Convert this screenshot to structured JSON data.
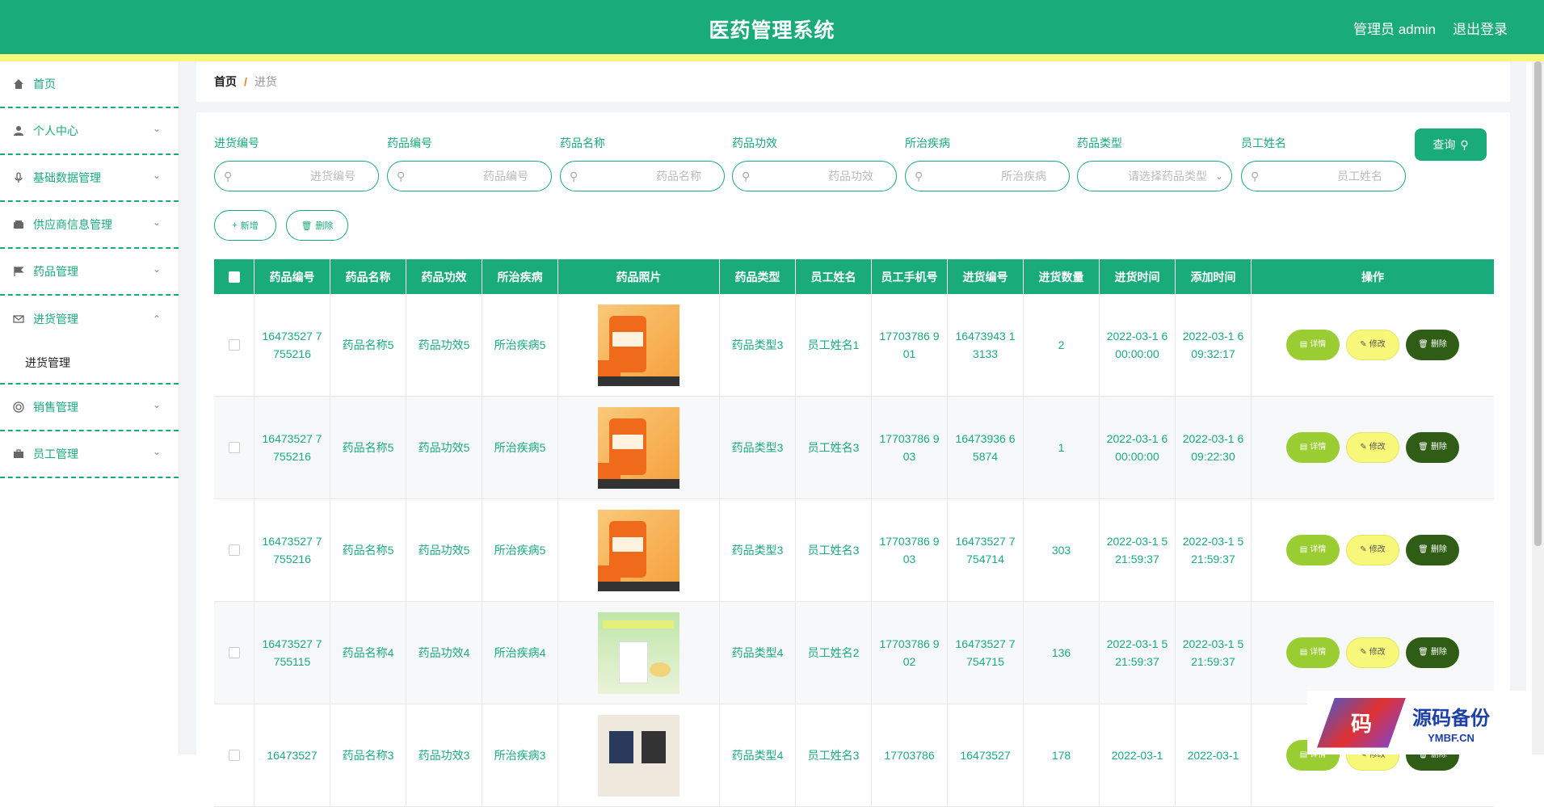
{
  "header": {
    "title": "医药管理系统",
    "user": "管理员 admin",
    "logout": "退出登录"
  },
  "sidebar": {
    "items": [
      {
        "label": "首页",
        "icon": "home-icon"
      },
      {
        "label": "个人中心",
        "icon": "user-icon"
      },
      {
        "label": "基础数据管理",
        "icon": "microphone-icon"
      },
      {
        "label": "供应商信息管理",
        "icon": "wallet-icon"
      },
      {
        "label": "药品管理",
        "icon": "flag-icon"
      },
      {
        "label": "进货管理",
        "icon": "mail-icon",
        "submenu": "进货管理"
      },
      {
        "label": "销售管理",
        "icon": "lifebuoy-icon"
      },
      {
        "label": "员工管理",
        "icon": "briefcase-icon"
      }
    ]
  },
  "breadcrumb": {
    "home": "首页",
    "separator": "/",
    "current": "进货"
  },
  "filters": [
    {
      "label": "进货编号",
      "placeholder": "进货编号"
    },
    {
      "label": "药品编号",
      "placeholder": "药品编号"
    },
    {
      "label": "药品名称",
      "placeholder": "药品名称"
    },
    {
      "label": "药品功效",
      "placeholder": "药品功效"
    },
    {
      "label": "所治疾病",
      "placeholder": "所治疾病"
    },
    {
      "label": "药品类型",
      "placeholder": "请选择药品类型"
    },
    {
      "label": "员工姓名",
      "placeholder": "员工姓名"
    }
  ],
  "buttons": {
    "query": "查询",
    "add": "新增",
    "delete": "删除"
  },
  "table": {
    "headers": [
      "药品编号",
      "药品名称",
      "药品功效",
      "所治疾病",
      "药品照片",
      "药品类型",
      "员工姓名",
      "员工手机号",
      "进货编号",
      "进货数量",
      "进货时间",
      "添加时间",
      "操作"
    ],
    "ops": {
      "detail": "详情",
      "edit": "修改",
      "delete": "删除"
    },
    "rows": [
      {
        "drug_no": "16473527 7755216",
        "name": "药品名称5",
        "effect": "药品功效5",
        "disease": "所治疾病5",
        "image": "orange",
        "type": "药品类型3",
        "staff": "员工姓名1",
        "phone": "17703786 901",
        "purchase_no": "16473943 13133",
        "qty": "2",
        "purchase_time": "2022-03-1 6 00:00:00",
        "add_time": "2022-03-1 6 09:32:17"
      },
      {
        "drug_no": "16473527 7755216",
        "name": "药品名称5",
        "effect": "药品功效5",
        "disease": "所治疾病5",
        "image": "orange",
        "type": "药品类型3",
        "staff": "员工姓名3",
        "phone": "17703786 903",
        "purchase_no": "16473936 65874",
        "qty": "1",
        "purchase_time": "2022-03-1 6 00:00:00",
        "add_time": "2022-03-1 6 09:22:30"
      },
      {
        "drug_no": "16473527 7755216",
        "name": "药品名称5",
        "effect": "药品功效5",
        "disease": "所治疾病5",
        "image": "orange",
        "type": "药品类型3",
        "staff": "员工姓名3",
        "phone": "17703786 903",
        "purchase_no": "16473527 7754714",
        "qty": "303",
        "purchase_time": "2022-03-1 5 21:59:37",
        "add_time": "2022-03-1 5 21:59:37"
      },
      {
        "drug_no": "16473527 7755115",
        "name": "药品名称4",
        "effect": "药品功效4",
        "disease": "所治疾病4",
        "image": "green",
        "type": "药品类型4",
        "staff": "员工姓名2",
        "phone": "17703786 902",
        "purchase_no": "16473527 7754715",
        "qty": "136",
        "purchase_time": "2022-03-1 5 21:59:37",
        "add_time": "2022-03-1 5 21:59:37"
      },
      {
        "drug_no": "16473527",
        "name": "药品名称3",
        "effect": "药品功效3",
        "disease": "所治疾病3",
        "image": "dark",
        "type": "药品类型4",
        "staff": "员工姓名3",
        "phone": "17703786",
        "purchase_no": "16473527",
        "qty": "178",
        "purchase_time": "2022-03-1",
        "add_time": "2022-03-1"
      }
    ]
  },
  "watermark": {
    "cn": "源码备份",
    "en": "YMBF.CN",
    "glyph": "码"
  }
}
